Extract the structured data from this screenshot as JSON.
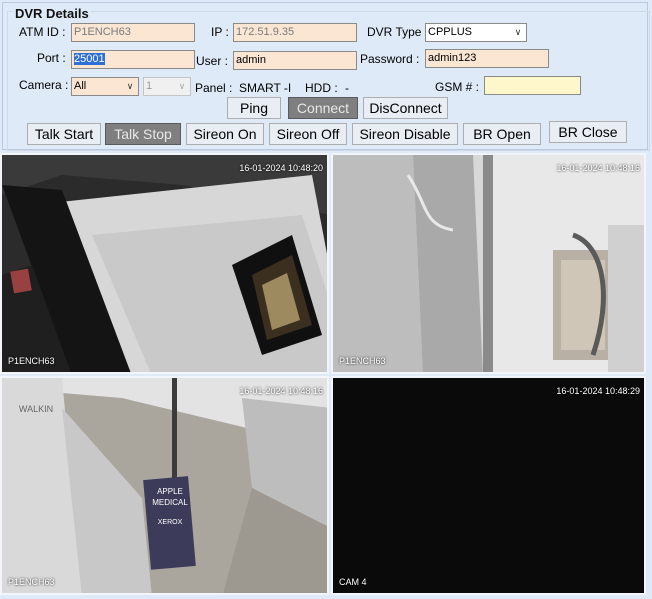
{
  "title": "DVR Details",
  "form": {
    "atm_id_label": "ATM ID :",
    "atm_id_value": "P1ENCH63",
    "ip_label": "IP :",
    "ip_value": "172.51.9.35",
    "dvr_type_label": "DVR Type :",
    "dvr_type_value": "CPPLUS",
    "port_label": "Port :",
    "port_value": "25001",
    "user_label": "User :",
    "user_value": "admin",
    "password_label": "Password :",
    "password_value": "admin123",
    "camera_label": "Camera :",
    "camera_value": "All",
    "camera_no_value": "1",
    "panel_label": "Panel :",
    "panel_value": "SMART -I",
    "hdd_label": "HDD :",
    "hdd_value": "-",
    "gsm_label": "GSM # :",
    "gsm_value": ""
  },
  "buttons": {
    "ping": "Ping",
    "connect": "Connect",
    "disconnect": "DisConnect",
    "talk_start": "Talk Start",
    "talk_stop": "Talk Stop",
    "sireon_on": "Sireon On",
    "sireon_off": "Sireon Off",
    "sireon_disable": "Sireon Disable",
    "br_open": "BR Open",
    "br_close": "BR Close"
  },
  "cameras": [
    {
      "timestamp": "16-01-2024 10:48:20",
      "name": "P1ENCH63"
    },
    {
      "timestamp": "16-01-2024 10:48:16",
      "name": "P1ENCH63"
    },
    {
      "timestamp": "16-01-2024 10:48:16",
      "name": "P1ENCH63"
    },
    {
      "timestamp": "16-01-2024 10:48:29",
      "name": "CAM 4"
    }
  ],
  "scene_text": {
    "sign_line1": "APPLE",
    "sign_line2": "MEDICAL",
    "sign_line3": "XEROX",
    "wall_sign": "WALKIN"
  },
  "colors": {
    "input_bg": "#fbe6d3",
    "gsm_bg": "#fff7cc",
    "pressed_btn": "#7f7f7f"
  }
}
